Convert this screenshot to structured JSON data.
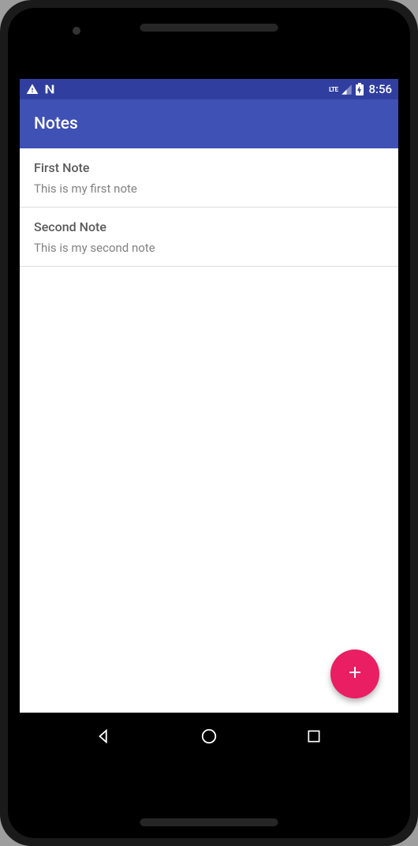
{
  "status": {
    "clock": "8:56",
    "network_label": "LTE"
  },
  "appbar": {
    "title": "Notes"
  },
  "notes": [
    {
      "title": "First Note",
      "body": "This is my first note"
    },
    {
      "title": "Second Note",
      "body": "This is my second note"
    }
  ],
  "fab": {
    "icon": "plus"
  }
}
